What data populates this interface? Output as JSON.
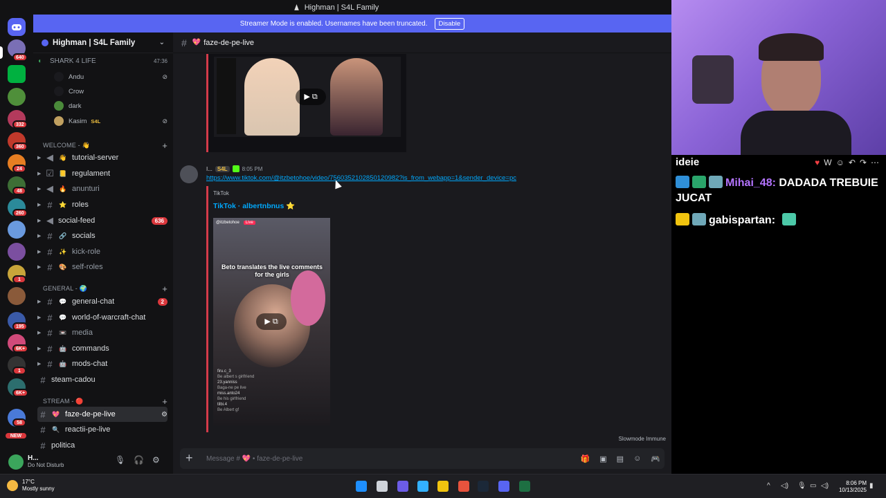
{
  "window": {
    "title": "Highman | S4L Family"
  },
  "banner": {
    "text": "Streamer Mode is enabled. Usernames have been truncated.",
    "button": "Disable"
  },
  "rail": {
    "badges": [
      "640",
      "332",
      "360",
      "24",
      "48",
      "260",
      "1",
      "195",
      "6K+",
      "1",
      "6K+",
      "58",
      "NEW"
    ]
  },
  "guild": {
    "name": "Highman | S4L Family"
  },
  "voice": {
    "channel": "SHARK 4 LIFE",
    "timer": "47:36",
    "users": [
      "Andu",
      "Crow",
      "dark",
      "Kasim"
    ],
    "kasim_tag": "S4L"
  },
  "categories": {
    "welcome": "WELCOME - 👋",
    "general": "GENERAL - 🌍",
    "stream": "STREAM - 🔴"
  },
  "channels": {
    "welcome": [
      {
        "name": "tutorial-server",
        "badge": ""
      },
      {
        "name": "regulament",
        "badge": ""
      },
      {
        "name": "anunturi",
        "badge": ""
      },
      {
        "name": "roles",
        "badge": ""
      },
      {
        "name": "social-feed",
        "badge": "636"
      },
      {
        "name": "socials",
        "badge": ""
      },
      {
        "name": "kick-role",
        "badge": ""
      },
      {
        "name": "self-roles",
        "badge": ""
      }
    ],
    "general": [
      {
        "name": "general-chat",
        "badge": "2"
      },
      {
        "name": "world-of-warcraft-chat",
        "badge": ""
      },
      {
        "name": "media",
        "badge": ""
      },
      {
        "name": "commands",
        "badge": ""
      },
      {
        "name": "mods-chat",
        "badge": ""
      },
      {
        "name": "steam-cadou",
        "badge": ""
      }
    ],
    "stream": [
      {
        "name": "faze-de-pe-live",
        "badge": ""
      },
      {
        "name": "reactii-pe-live",
        "badge": ""
      },
      {
        "name": "politica",
        "badge": ""
      }
    ]
  },
  "user": {
    "name": "H...",
    "status": "Do Not Disturb"
  },
  "chat": {
    "channel": "faze-de-pe-live",
    "message": {
      "author": "I...",
      "tag": "S4L",
      "time": "8:05 PM",
      "link": "https://www.tiktok.com/@itzbetohoe/video/7560352102850120982?is_from_webapp=1&sender_device=pc",
      "embed_provider": "TikTok",
      "embed_title": "TikTok · albertnbnus ⭐",
      "video_caption": "Beto translates the live comments for the girls",
      "video_handle": "@itzbetohoe",
      "video_comments": [
        "firu.c_3",
        "Be albert s girlfriend",
        "23.yanniss",
        "Baga-ne pe live",
        "miss.anto24",
        "Be his girlfriend",
        "tilbi.4",
        "Be Albert gf"
      ]
    },
    "input_placeholder": "Message # 💖 • faze-de-pe-live",
    "slowmode": "Slowmode Immune"
  },
  "overlay": {
    "title": "ideie",
    "msg1_user": "Mihai_48:",
    "msg1_text": "DADADA TREBUIE JUCAT",
    "msg2_user": "gabispartan:"
  },
  "taskbar": {
    "temp": "17°C",
    "weather": "Mostly sunny",
    "time": "8:06 PM",
    "date": "10/13/2025"
  }
}
